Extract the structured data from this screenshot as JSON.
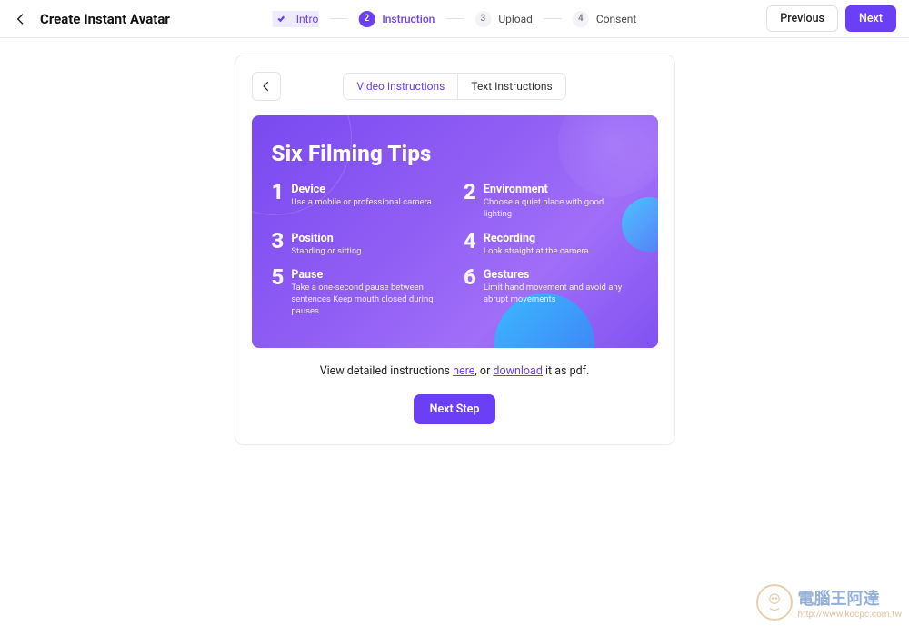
{
  "header": {
    "title": "Create Instant Avatar",
    "prev_button": "Previous",
    "next_button": "Next"
  },
  "stepper": {
    "steps": [
      {
        "num": "",
        "label": "Intro",
        "state": "done"
      },
      {
        "num": "2",
        "label": "Instruction",
        "state": "active"
      },
      {
        "num": "3",
        "label": "Upload",
        "state": "pending"
      },
      {
        "num": "4",
        "label": "Consent",
        "state": "pending"
      }
    ]
  },
  "tabs": {
    "video": "Video Instructions",
    "text": "Text Instructions"
  },
  "hero": {
    "title": "Six Filming Tips",
    "tips": [
      {
        "num": "1",
        "title": "Device",
        "desc": "Use a mobile or professional camera"
      },
      {
        "num": "2",
        "title": "Environment",
        "desc": "Choose a quiet place with good lighting"
      },
      {
        "num": "3",
        "title": "Position",
        "desc": "Standing or sitting"
      },
      {
        "num": "4",
        "title": "Recording",
        "desc": "Look straight at the camera"
      },
      {
        "num": "5",
        "title": "Pause",
        "desc": "Take a one-second pause between sentences Keep mouth closed during pauses"
      },
      {
        "num": "6",
        "title": "Gestures",
        "desc": "Limit hand movement and avoid any abrupt movements"
      }
    ]
  },
  "instructions_line": {
    "pre": "View detailed instructions ",
    "link1": "here",
    "mid": ", or ",
    "link2": "download",
    "post": " it as pdf."
  },
  "next_step_button": "Next Step",
  "watermark": {
    "main": "電腦王阿達",
    "url": "http://www.kocpc.com.tw"
  }
}
